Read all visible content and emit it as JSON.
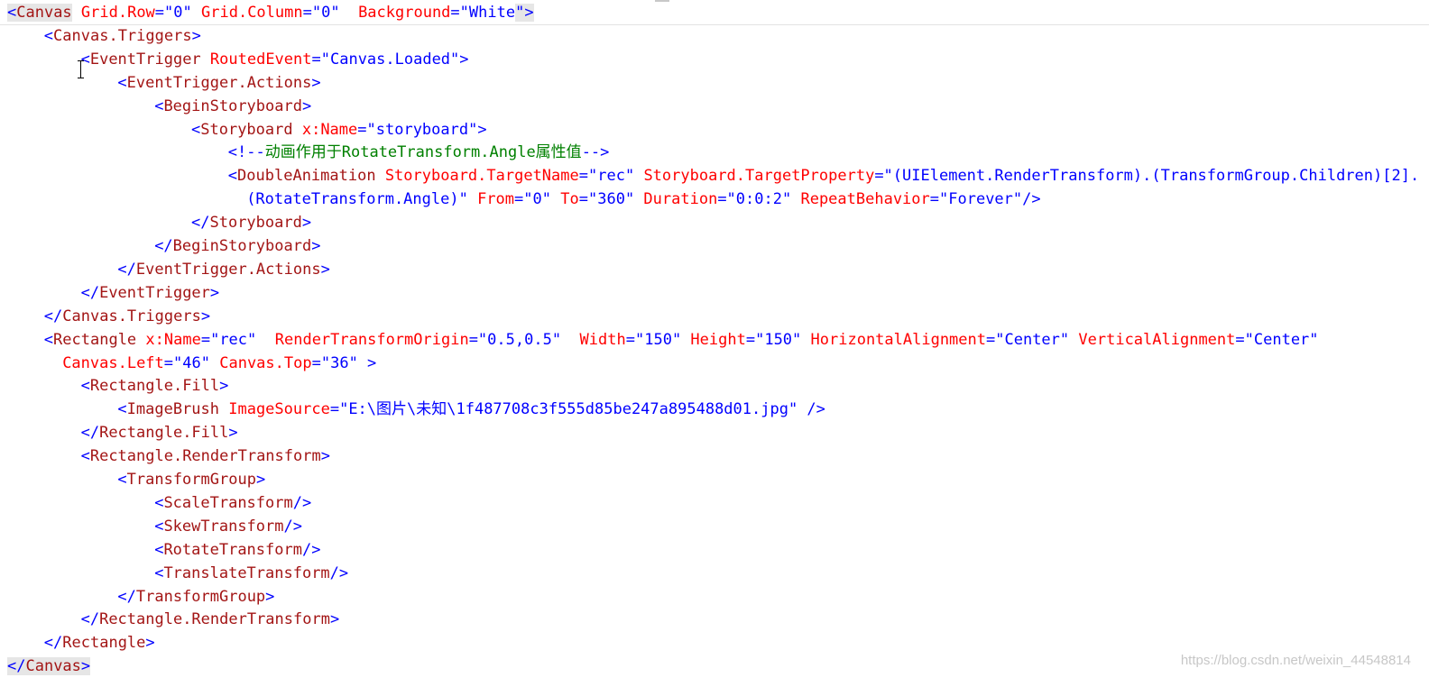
{
  "editor": {
    "lines": [
      {
        "indent": 0,
        "segments": [
          {
            "k": "b",
            "t": "<"
          },
          {
            "k": "t",
            "t": "Canvas"
          },
          {
            "k": "a",
            "t": " Grid.Row"
          },
          {
            "k": "p",
            "t": "=\""
          },
          {
            "k": "v",
            "t": "0"
          },
          {
            "k": "p",
            "t": "\""
          },
          {
            "k": "a",
            "t": " Grid.Column"
          },
          {
            "k": "p",
            "t": "=\""
          },
          {
            "k": "v",
            "t": "0"
          },
          {
            "k": "p",
            "t": "\""
          },
          {
            "k": "a",
            "t": "  Background"
          },
          {
            "k": "p",
            "t": "=\""
          },
          {
            "k": "v",
            "t": "White"
          },
          {
            "k": "p",
            "t": "\">"
          }
        ],
        "highlight": true
      },
      {
        "indent": 4,
        "segments": [
          {
            "k": "b",
            "t": "<"
          },
          {
            "k": "t",
            "t": "Canvas.Triggers"
          },
          {
            "k": "b",
            "t": ">"
          }
        ]
      },
      {
        "indent": 8,
        "segments": [
          {
            "k": "b",
            "t": "<"
          },
          {
            "k": "t",
            "t": "EventTrigger"
          },
          {
            "k": "a",
            "t": " RoutedEvent"
          },
          {
            "k": "p",
            "t": "=\""
          },
          {
            "k": "v",
            "t": "Canvas.Loaded"
          },
          {
            "k": "p",
            "t": "\">"
          }
        ]
      },
      {
        "indent": 12,
        "segments": [
          {
            "k": "b",
            "t": "<"
          },
          {
            "k": "t",
            "t": "EventTrigger.Actions"
          },
          {
            "k": "b",
            "t": ">"
          }
        ]
      },
      {
        "indent": 16,
        "segments": [
          {
            "k": "b",
            "t": "<"
          },
          {
            "k": "t",
            "t": "BeginStoryboard"
          },
          {
            "k": "b",
            "t": ">"
          }
        ]
      },
      {
        "indent": 20,
        "segments": [
          {
            "k": "b",
            "t": "<"
          },
          {
            "k": "t",
            "t": "Storyboard"
          },
          {
            "k": "a",
            "t": " x:Name"
          },
          {
            "k": "p",
            "t": "=\""
          },
          {
            "k": "v",
            "t": "storyboard"
          },
          {
            "k": "p",
            "t": "\">"
          }
        ]
      },
      {
        "indent": 24,
        "segments": [
          {
            "k": "b",
            "t": "<!--"
          },
          {
            "k": "c",
            "t": "动画作用于RotateTransform.Angle属性值"
          },
          {
            "k": "b",
            "t": "-->"
          }
        ]
      },
      {
        "indent": 24,
        "segments": [
          {
            "k": "b",
            "t": "<"
          },
          {
            "k": "t",
            "t": "DoubleAnimation"
          },
          {
            "k": "a",
            "t": " Storyboard.TargetName"
          },
          {
            "k": "p",
            "t": "=\""
          },
          {
            "k": "v",
            "t": "rec"
          },
          {
            "k": "p",
            "t": "\""
          },
          {
            "k": "a",
            "t": " Storyboard.TargetProperty"
          },
          {
            "k": "p",
            "t": "=\""
          },
          {
            "k": "v",
            "t": "(UIElement.RenderTransform).(TransformGroup.Children)[2]."
          }
        ]
      },
      {
        "indent": 26,
        "segments": [
          {
            "k": "v",
            "t": "(RotateTransform.Angle)"
          },
          {
            "k": "p",
            "t": "\""
          },
          {
            "k": "a",
            "t": " From"
          },
          {
            "k": "p",
            "t": "=\""
          },
          {
            "k": "v",
            "t": "0"
          },
          {
            "k": "p",
            "t": "\""
          },
          {
            "k": "a",
            "t": " To"
          },
          {
            "k": "p",
            "t": "=\""
          },
          {
            "k": "v",
            "t": "360"
          },
          {
            "k": "p",
            "t": "\""
          },
          {
            "k": "a",
            "t": " Duration"
          },
          {
            "k": "p",
            "t": "=\""
          },
          {
            "k": "v",
            "t": "0:0:2"
          },
          {
            "k": "p",
            "t": "\""
          },
          {
            "k": "a",
            "t": " RepeatBehavior"
          },
          {
            "k": "p",
            "t": "=\""
          },
          {
            "k": "v",
            "t": "Forever"
          },
          {
            "k": "p",
            "t": "\"/>"
          }
        ]
      },
      {
        "indent": 20,
        "segments": [
          {
            "k": "b",
            "t": "</"
          },
          {
            "k": "t",
            "t": "Storyboard"
          },
          {
            "k": "b",
            "t": ">"
          }
        ]
      },
      {
        "indent": 16,
        "segments": [
          {
            "k": "b",
            "t": "</"
          },
          {
            "k": "t",
            "t": "BeginStoryboard"
          },
          {
            "k": "b",
            "t": ">"
          }
        ]
      },
      {
        "indent": 12,
        "segments": [
          {
            "k": "b",
            "t": "</"
          },
          {
            "k": "t",
            "t": "EventTrigger.Actions"
          },
          {
            "k": "b",
            "t": ">"
          }
        ]
      },
      {
        "indent": 8,
        "segments": [
          {
            "k": "b",
            "t": "</"
          },
          {
            "k": "t",
            "t": "EventTrigger"
          },
          {
            "k": "b",
            "t": ">"
          }
        ]
      },
      {
        "indent": 4,
        "segments": [
          {
            "k": "b",
            "t": "</"
          },
          {
            "k": "t",
            "t": "Canvas.Triggers"
          },
          {
            "k": "b",
            "t": ">"
          }
        ]
      },
      {
        "indent": 4,
        "segments": [
          {
            "k": "b",
            "t": "<"
          },
          {
            "k": "t",
            "t": "Rectangle"
          },
          {
            "k": "a",
            "t": " x:Name"
          },
          {
            "k": "p",
            "t": "=\""
          },
          {
            "k": "v",
            "t": "rec"
          },
          {
            "k": "p",
            "t": "\""
          },
          {
            "k": "a",
            "t": "  RenderTransformOrigin"
          },
          {
            "k": "p",
            "t": "=\""
          },
          {
            "k": "v",
            "t": "0.5,0.5"
          },
          {
            "k": "p",
            "t": "\""
          },
          {
            "k": "a",
            "t": "  Width"
          },
          {
            "k": "p",
            "t": "=\""
          },
          {
            "k": "v",
            "t": "150"
          },
          {
            "k": "p",
            "t": "\""
          },
          {
            "k": "a",
            "t": " Height"
          },
          {
            "k": "p",
            "t": "=\""
          },
          {
            "k": "v",
            "t": "150"
          },
          {
            "k": "p",
            "t": "\""
          },
          {
            "k": "a",
            "t": " HorizontalAlignment"
          },
          {
            "k": "p",
            "t": "=\""
          },
          {
            "k": "v",
            "t": "Center"
          },
          {
            "k": "p",
            "t": "\""
          },
          {
            "k": "a",
            "t": " VerticalAlignment"
          },
          {
            "k": "p",
            "t": "=\""
          },
          {
            "k": "v",
            "t": "Center"
          },
          {
            "k": "p",
            "t": "\""
          }
        ]
      },
      {
        "indent": 6,
        "segments": [
          {
            "k": "a",
            "t": "Canvas.Left"
          },
          {
            "k": "p",
            "t": "=\""
          },
          {
            "k": "v",
            "t": "46"
          },
          {
            "k": "p",
            "t": "\""
          },
          {
            "k": "a",
            "t": " Canvas.Top"
          },
          {
            "k": "p",
            "t": "=\""
          },
          {
            "k": "v",
            "t": "36"
          },
          {
            "k": "p",
            "t": "\" >"
          }
        ]
      },
      {
        "indent": 8,
        "segments": [
          {
            "k": "b",
            "t": "<"
          },
          {
            "k": "t",
            "t": "Rectangle.Fill"
          },
          {
            "k": "b",
            "t": ">"
          }
        ]
      },
      {
        "indent": 12,
        "segments": [
          {
            "k": "b",
            "t": "<"
          },
          {
            "k": "t",
            "t": "ImageBrush"
          },
          {
            "k": "a",
            "t": " ImageSource"
          },
          {
            "k": "p",
            "t": "=\""
          },
          {
            "k": "v",
            "t": "E:\\图片\\未知\\1f487708c3f555d85be247a895488d01.jpg"
          },
          {
            "k": "p",
            "t": "\" />"
          }
        ]
      },
      {
        "indent": 8,
        "segments": [
          {
            "k": "b",
            "t": "</"
          },
          {
            "k": "t",
            "t": "Rectangle.Fill"
          },
          {
            "k": "b",
            "t": ">"
          }
        ]
      },
      {
        "indent": 8,
        "segments": [
          {
            "k": "b",
            "t": "<"
          },
          {
            "k": "t",
            "t": "Rectangle.RenderTransform"
          },
          {
            "k": "b",
            "t": ">"
          }
        ]
      },
      {
        "indent": 12,
        "segments": [
          {
            "k": "b",
            "t": "<"
          },
          {
            "k": "t",
            "t": "TransformGroup"
          },
          {
            "k": "b",
            "t": ">"
          }
        ]
      },
      {
        "indent": 16,
        "segments": [
          {
            "k": "b",
            "t": "<"
          },
          {
            "k": "t",
            "t": "ScaleTransform"
          },
          {
            "k": "b",
            "t": "/>"
          }
        ]
      },
      {
        "indent": 16,
        "segments": [
          {
            "k": "b",
            "t": "<"
          },
          {
            "k": "t",
            "t": "SkewTransform"
          },
          {
            "k": "b",
            "t": "/>"
          }
        ]
      },
      {
        "indent": 16,
        "segments": [
          {
            "k": "b",
            "t": "<"
          },
          {
            "k": "t",
            "t": "RotateTransform"
          },
          {
            "k": "b",
            "t": "/>"
          }
        ]
      },
      {
        "indent": 16,
        "segments": [
          {
            "k": "b",
            "t": "<"
          },
          {
            "k": "t",
            "t": "TranslateTransform"
          },
          {
            "k": "b",
            "t": "/>"
          }
        ]
      },
      {
        "indent": 12,
        "segments": [
          {
            "k": "b",
            "t": "</"
          },
          {
            "k": "t",
            "t": "TransformGroup"
          },
          {
            "k": "b",
            "t": ">"
          }
        ]
      },
      {
        "indent": 8,
        "segments": [
          {
            "k": "b",
            "t": "</"
          },
          {
            "k": "t",
            "t": "Rectangle.RenderTransform"
          },
          {
            "k": "b",
            "t": ">"
          }
        ]
      },
      {
        "indent": 4,
        "segments": [
          {
            "k": "b",
            "t": "</"
          },
          {
            "k": "t",
            "t": "Rectangle"
          },
          {
            "k": "b",
            "t": ">"
          }
        ]
      },
      {
        "indent": 0,
        "segments": [
          {
            "k": "b",
            "t": "</"
          },
          {
            "k": "t",
            "t": "Canvas"
          },
          {
            "k": "b",
            "t": ">"
          }
        ],
        "highlight": true
      }
    ],
    "colors": {
      "bracket": "#0000ff",
      "tag": "#a31515",
      "attribute": "#ff0000",
      "value": "#0000ff",
      "comment": "#008000",
      "background": "#ffffff",
      "highlight": "#e6e6e6"
    },
    "cursor": "i-beam-cursor-icon"
  },
  "watermark": {
    "text": "https://blog.csdn.net/weixin_44548814"
  }
}
